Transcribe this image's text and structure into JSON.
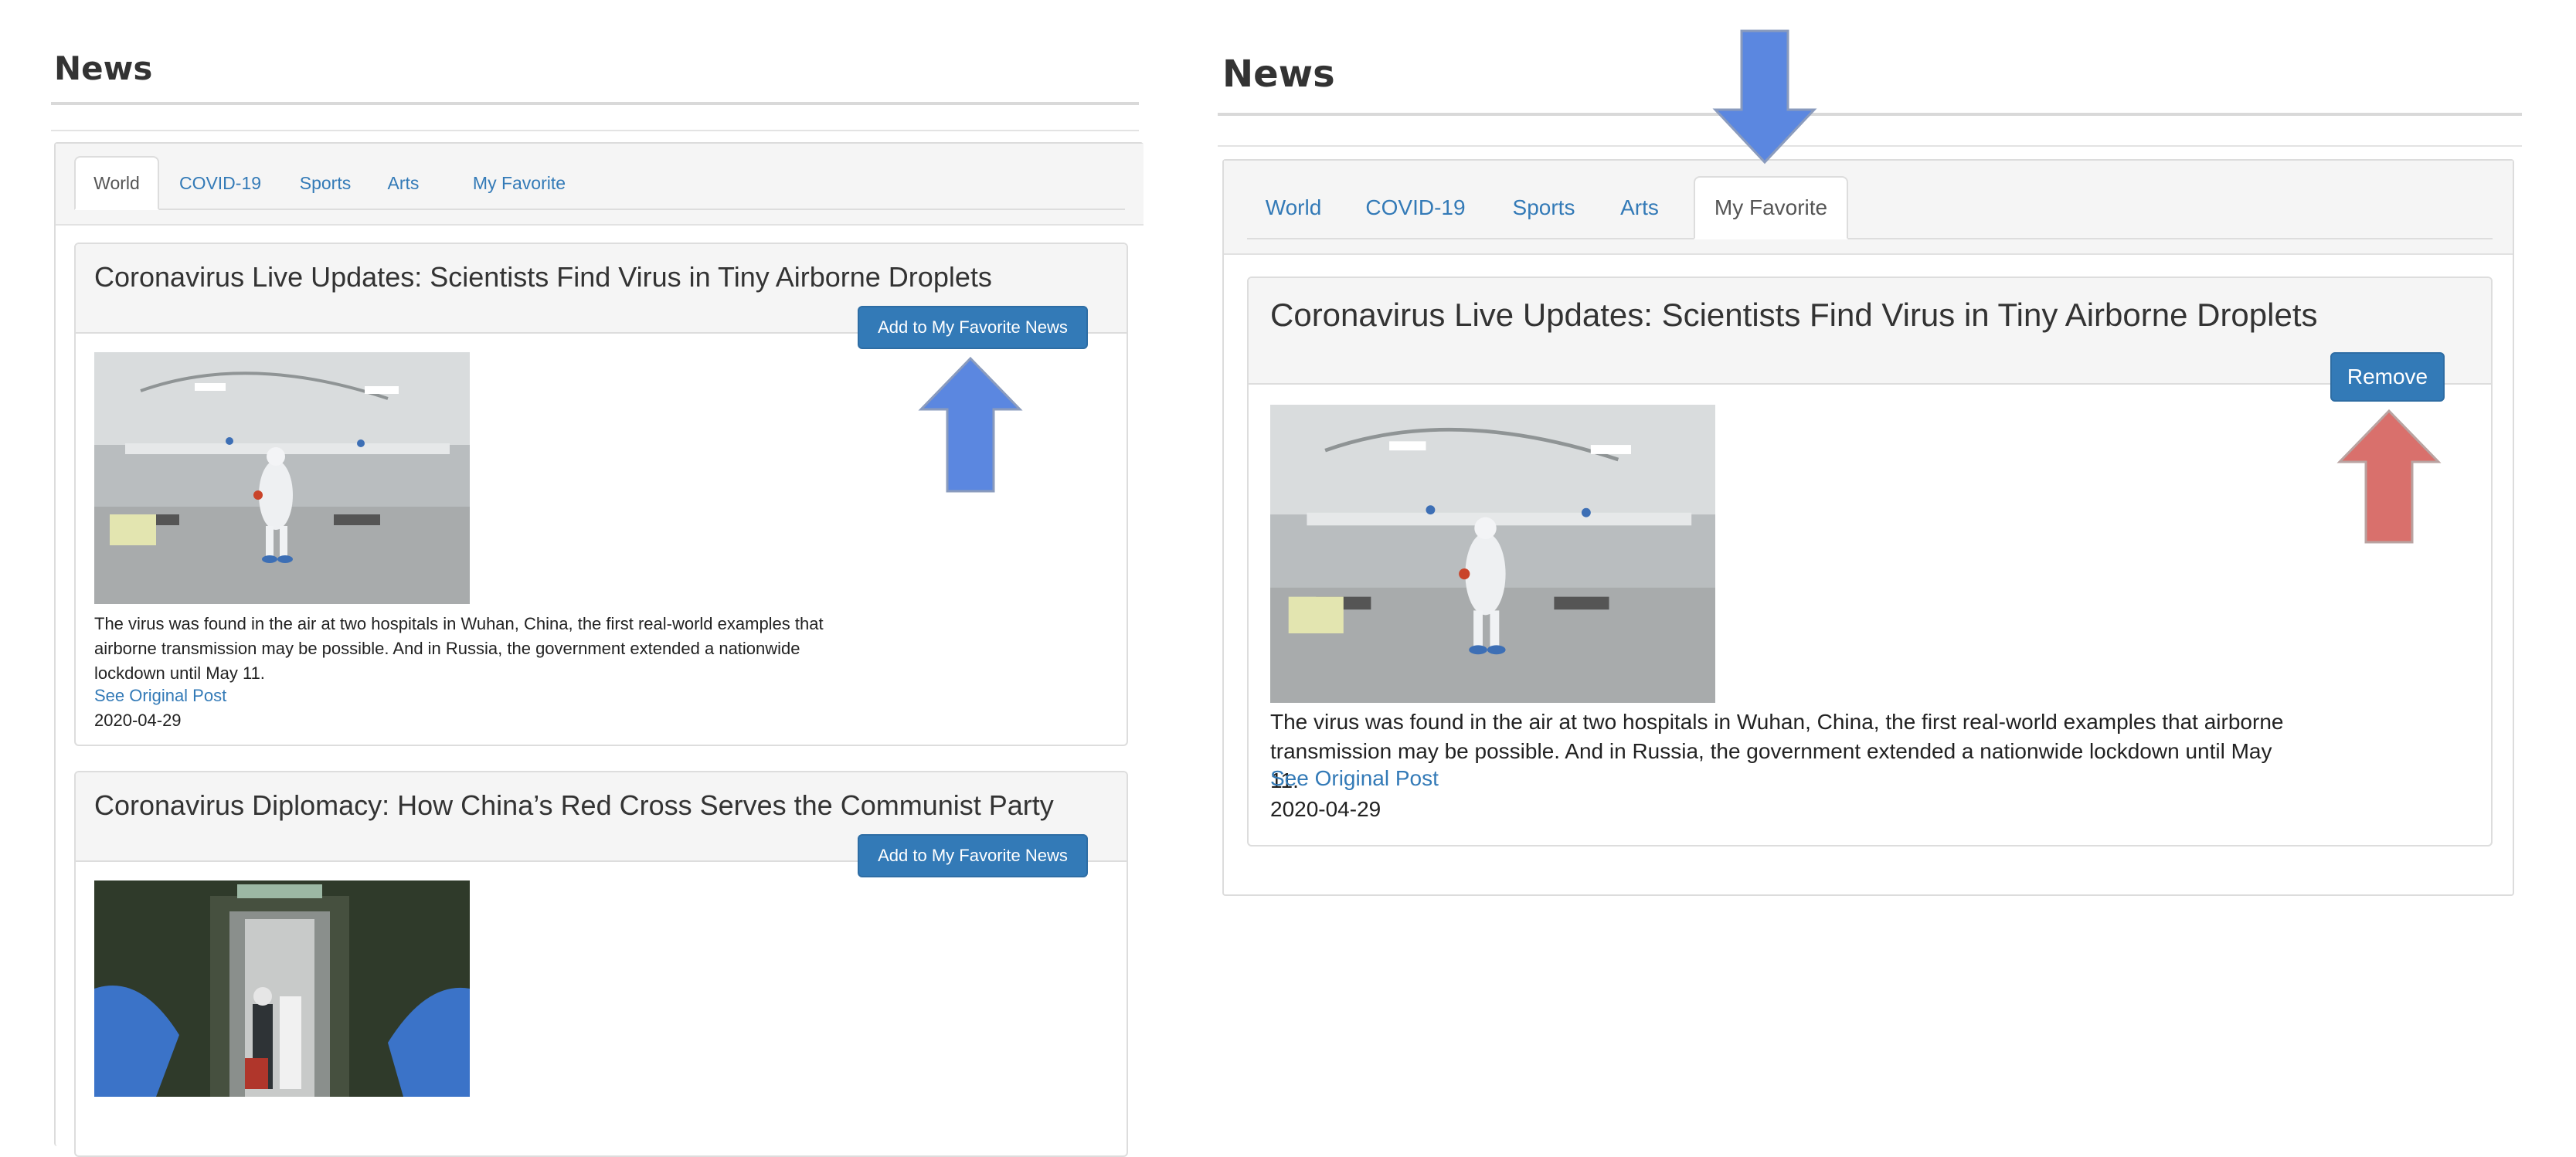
{
  "left": {
    "heading": "News",
    "tabs": [
      {
        "label": "World",
        "active": true
      },
      {
        "label": "COVID-19",
        "active": false
      },
      {
        "label": "Sports",
        "active": false
      },
      {
        "label": "Arts",
        "active": false
      },
      {
        "label": "My Favorite",
        "active": false
      }
    ],
    "articles": [
      {
        "title": "Coronavirus Live Updates: Scientists Find Virus in Tiny Airborne Droplets",
        "button": "Add to My Favorite News",
        "description": "The virus was found in the air at two hospitals in Wuhan, China, the first real-world examples that airborne transmission may be possible. And in Russia, the government extended a nationwide lockdown until May 11.",
        "link": "See Original Post",
        "date": "2020-04-29"
      },
      {
        "title": "Coronavirus Diplomacy: How China’s Red Cross Serves the Communist Party",
        "button": "Add to My Favorite News"
      }
    ]
  },
  "right": {
    "heading": "News",
    "tabs": [
      {
        "label": "World",
        "active": false
      },
      {
        "label": "COVID-19",
        "active": false
      },
      {
        "label": "Sports",
        "active": false
      },
      {
        "label": "Arts",
        "active": false
      },
      {
        "label": "My Favorite",
        "active": true
      }
    ],
    "article": {
      "title": "Coronavirus Live Updates: Scientists Find Virus in Tiny Airborne Droplets",
      "button": "Remove",
      "description": "The virus was found in the air at two hospitals in Wuhan, China, the first real-world examples that airborne transmission may be possible. And in Russia, the government extended a nationwide lockdown until May 11.",
      "link": "See Original Post",
      "date": "2020-04-29"
    }
  },
  "annotations": {
    "blue_arrow_color": "#5b87e0",
    "red_arrow_color": "#d9706c"
  }
}
